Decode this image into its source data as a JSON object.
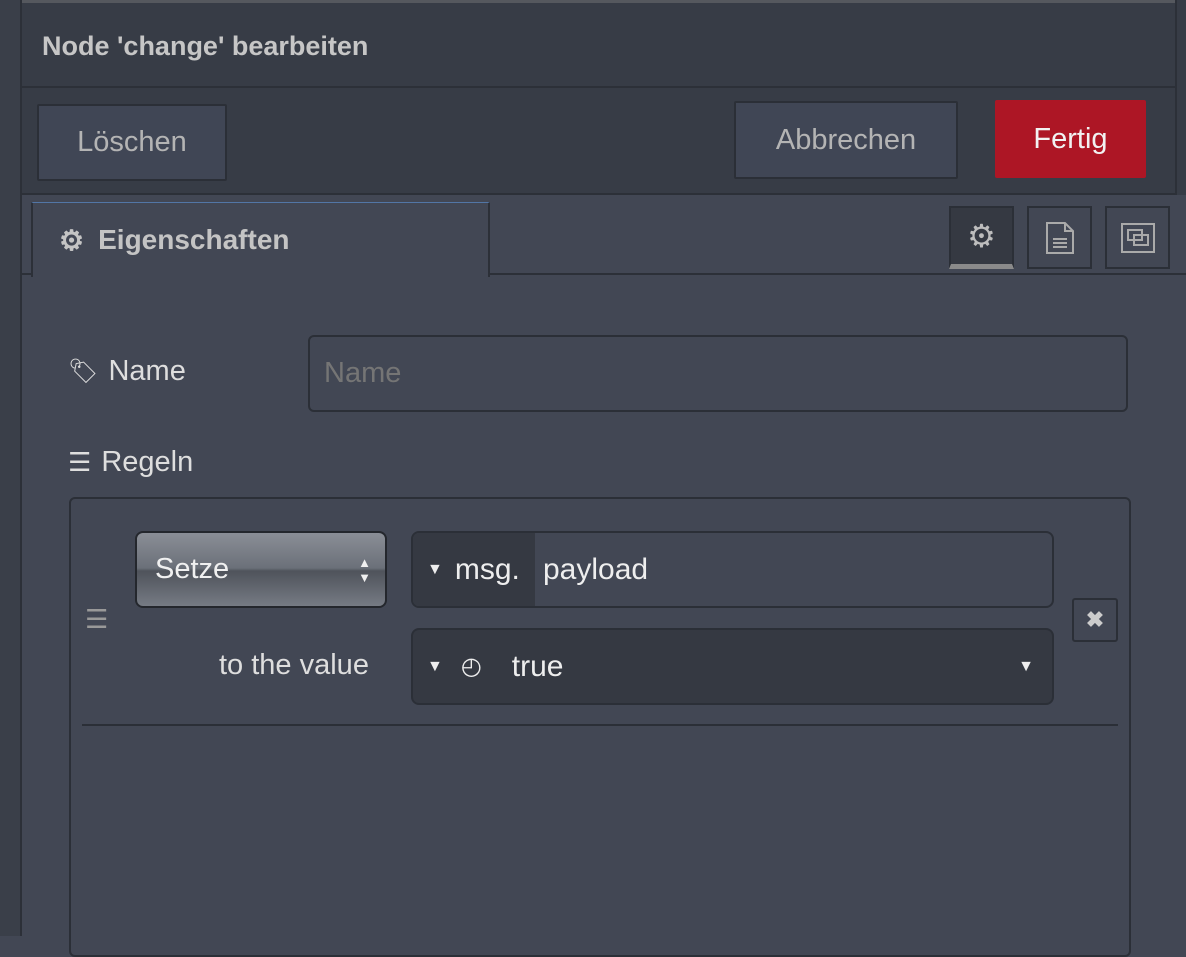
{
  "header": {
    "title": "Node 'change' bearbeiten"
  },
  "toolbar": {
    "delete_label": "Löschen",
    "cancel_label": "Abbrechen",
    "done_label": "Fertig",
    "done_color": "#ad1625"
  },
  "tabs": {
    "properties_label": "Eigenschaften",
    "icons": [
      "gear-icon",
      "document-icon",
      "frame-icon"
    ]
  },
  "form": {
    "name_label": "Name",
    "name_placeholder": "Name",
    "name_value": "",
    "rules_label": "Regeln"
  },
  "rule": {
    "action": "Setze",
    "target_prefix": "msg.",
    "target_value": "payload",
    "value_label": "to the value",
    "value": "true"
  }
}
